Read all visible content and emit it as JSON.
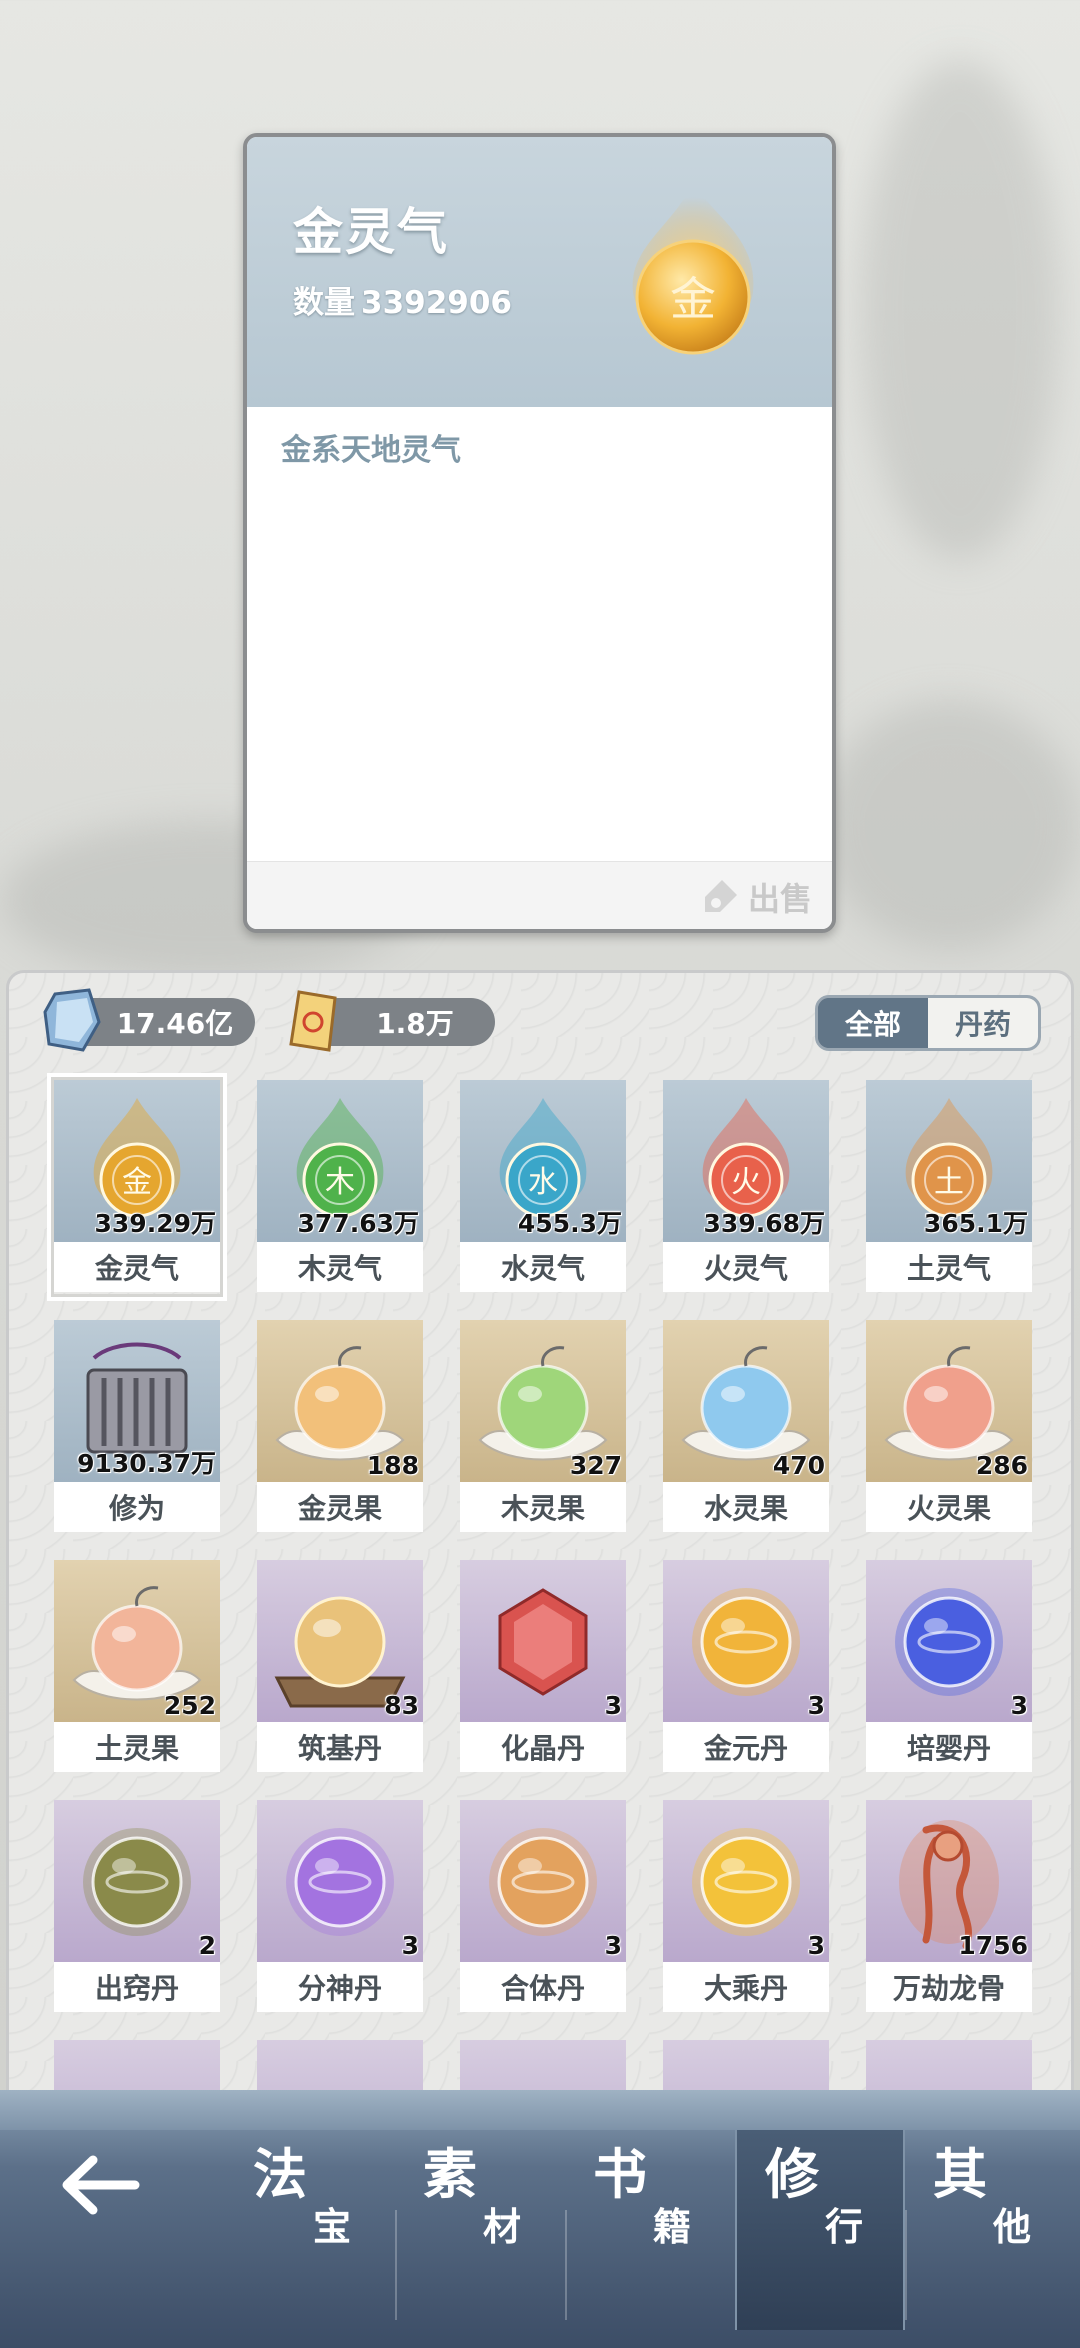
{
  "detail": {
    "title": "金灵气",
    "qty_label": "数量",
    "qty_value": "3392906",
    "glyph": "金",
    "description": "金系天地灵气",
    "sell_label": "出售"
  },
  "currencies": [
    {
      "icon": "spirit-stone-icon",
      "value": "17.46亿"
    },
    {
      "icon": "talisman-icon",
      "value": "1.8万"
    }
  ],
  "filter_tabs": [
    {
      "label": "全部",
      "active": true
    },
    {
      "label": "丹药",
      "active": false
    }
  ],
  "items": [
    {
      "name": "金灵气",
      "count": "339.29万",
      "kind": "qi",
      "glyph": "金",
      "color": "#e5a62f",
      "bg": "blue",
      "selected": true
    },
    {
      "name": "木灵气",
      "count": "377.63万",
      "kind": "qi",
      "glyph": "木",
      "color": "#4fb24b",
      "bg": "blue"
    },
    {
      "name": "水灵气",
      "count": "455.3万",
      "kind": "qi",
      "glyph": "水",
      "color": "#3aa6c9",
      "bg": "blue"
    },
    {
      "name": "火灵气",
      "count": "339.68万",
      "kind": "qi",
      "glyph": "火",
      "color": "#e8614b",
      "bg": "blue"
    },
    {
      "name": "土灵气",
      "count": "365.1万",
      "kind": "qi",
      "glyph": "土",
      "color": "#e0944a",
      "bg": "blue"
    },
    {
      "name": "修为",
      "count": "9130.37万",
      "kind": "scroll",
      "color": "#6a6a72",
      "bg": "blue"
    },
    {
      "name": "金灵果",
      "count": "188",
      "kind": "fruit",
      "color": "#f2c07a",
      "bg": "tan"
    },
    {
      "name": "木灵果",
      "count": "327",
      "kind": "fruit",
      "color": "#9fd67a",
      "bg": "tan"
    },
    {
      "name": "水灵果",
      "count": "470",
      "kind": "fruit",
      "color": "#8fc9ee",
      "bg": "tan"
    },
    {
      "name": "火灵果",
      "count": "286",
      "kind": "fruit",
      "color": "#f0a08c",
      "bg": "tan"
    },
    {
      "name": "土灵果",
      "count": "252",
      "kind": "fruit",
      "color": "#f2b59a",
      "bg": "tan"
    },
    {
      "name": "筑基丹",
      "count": "83",
      "kind": "pill-stand",
      "color": "#e9c27a",
      "bg": "purple"
    },
    {
      "name": "化晶丹",
      "count": "3",
      "kind": "crystal",
      "color": "#d9534f",
      "bg": "purple"
    },
    {
      "name": "金元丹",
      "count": "3",
      "kind": "pill",
      "color": "#f1b43a",
      "bg": "purple"
    },
    {
      "name": "培婴丹",
      "count": "3",
      "kind": "pill",
      "color": "#4a5fe0",
      "bg": "purple"
    },
    {
      "name": "出窍丹",
      "count": "2",
      "kind": "pill",
      "color": "#8a8a4a",
      "bg": "purple"
    },
    {
      "name": "分神丹",
      "count": "3",
      "kind": "pill",
      "color": "#a373e0",
      "bg": "purple"
    },
    {
      "name": "合体丹",
      "count": "3",
      "kind": "pill",
      "color": "#e3a25e",
      "bg": "purple"
    },
    {
      "name": "大乘丹",
      "count": "3",
      "kind": "pill",
      "color": "#f3c23a",
      "bg": "purple"
    },
    {
      "name": "万劫龙骨",
      "count": "1756",
      "kind": "dragon",
      "color": "#e08a62",
      "bg": "purple"
    }
  ],
  "nav": {
    "back_icon": "back-arrow-icon",
    "tabs": [
      {
        "big": "法",
        "small": "宝",
        "active": false
      },
      {
        "big": "素",
        "small": "材",
        "active": false
      },
      {
        "big": "书",
        "small": "籍",
        "active": false
      },
      {
        "big": "修",
        "small": "行",
        "active": true
      },
      {
        "big": "其",
        "small": "他",
        "active": false
      }
    ]
  }
}
